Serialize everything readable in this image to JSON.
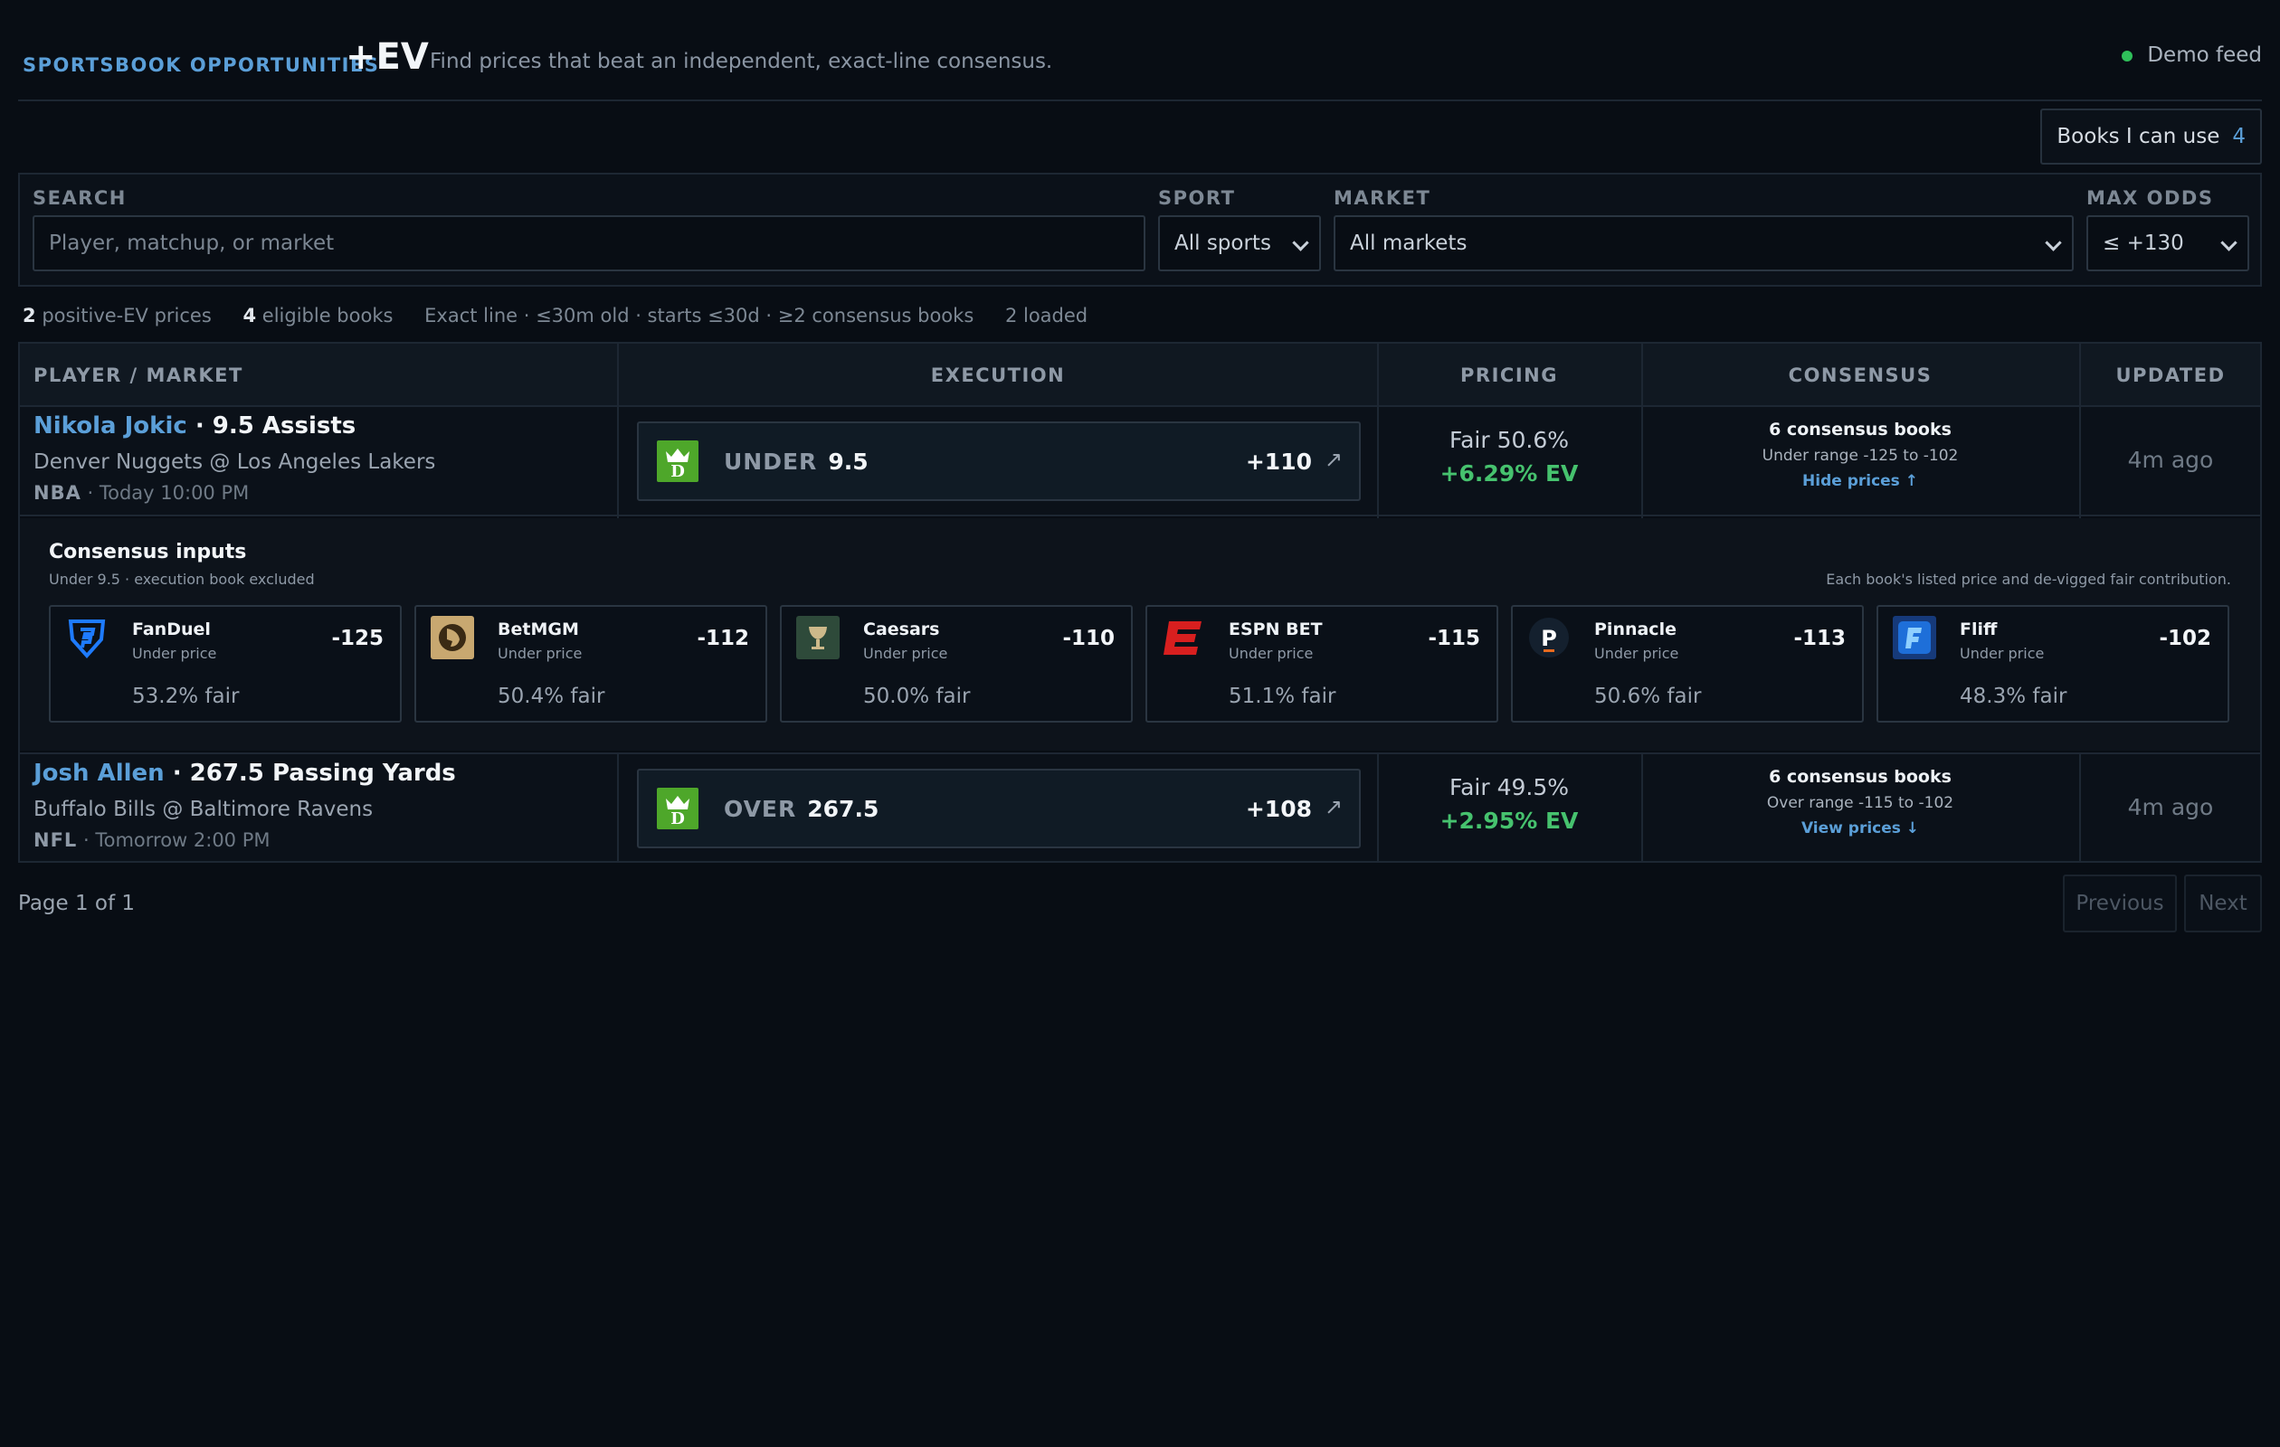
{
  "header": {
    "brand": "SPORTSBOOK OPPORTUNITIES",
    "ev_label": "+EV",
    "tagline": "Find prices that beat an independent, exact-line consensus.",
    "status": "Demo feed",
    "status_color": "#2fbf5a"
  },
  "books_button": {
    "label": "Books I can use",
    "count": "4"
  },
  "filters": {
    "search": {
      "label": "SEARCH",
      "placeholder": "Player, matchup, or market"
    },
    "sport": {
      "label": "SPORT",
      "value": "All sports"
    },
    "market": {
      "label": "MARKET",
      "value": "All markets"
    },
    "max_odds": {
      "label": "MAX ODDS",
      "value": "≤ +130"
    }
  },
  "stats": {
    "positive_count": "2",
    "positive_label": "positive-EV prices",
    "eligible_count": "4",
    "eligible_label": "eligible books",
    "rules": "Exact line · ≤30m old · starts ≤30d · ≥2 consensus books",
    "loaded": "2 loaded"
  },
  "table": {
    "columns": [
      "PLAYER / MARKET",
      "EXECUTION",
      "PRICING",
      "CONSENSUS",
      "UPDATED"
    ],
    "rows": [
      {
        "player": "Nikola Jokic",
        "market": " · 9.5 Assists",
        "matchup": "Denver Nuggets @ Los Angeles Lakers",
        "league": "NBA",
        "time": " · Today 10:00 PM",
        "side": "UNDER",
        "line": "9.5",
        "odds": "+110",
        "fair": "Fair 50.6%",
        "ev": "+6.29% EV",
        "consensus_books": "6 consensus books",
        "consensus_range": "Under range -125 to -102",
        "consensus_toggle": "Hide prices ↑",
        "updated": "4m ago"
      },
      {
        "player": "Josh Allen",
        "market": " · 267.5 Passing Yards",
        "matchup": "Buffalo Bills @ Baltimore Ravens",
        "league": "NFL",
        "time": " · Tomorrow 2:00 PM",
        "side": "OVER",
        "line": "267.5",
        "odds": "+108",
        "fair": "Fair 49.5%",
        "ev": "+2.95% EV",
        "consensus_books": "6 consensus books",
        "consensus_range": "Over range -115 to -102",
        "consensus_toggle": "View prices ↓",
        "updated": "4m ago"
      }
    ]
  },
  "consensus_panel": {
    "title": "Consensus inputs",
    "subtitle": "Under 9.5 · execution book excluded",
    "note": "Each book's listed price and de-vigged fair contribution.",
    "books": [
      {
        "name": "FanDuel",
        "sub": "Under price",
        "price": "-125",
        "fair": "53.2% fair",
        "icon": "fanduel-icon",
        "color": "#1e7bff"
      },
      {
        "name": "BetMGM",
        "sub": "Under price",
        "price": "-112",
        "fair": "50.4% fair",
        "icon": "betmgm-icon",
        "color": "#c8a870"
      },
      {
        "name": "Caesars",
        "sub": "Under price",
        "price": "-110",
        "fair": "50.0% fair",
        "icon": "caesars-icon",
        "color": "#2e4a3a"
      },
      {
        "name": "ESPN BET",
        "sub": "Under price",
        "price": "-115",
        "fair": "51.1% fair",
        "icon": "espnbet-icon",
        "color": "#d81f1f"
      },
      {
        "name": "Pinnacle",
        "sub": "Under price",
        "price": "-113",
        "fair": "50.6% fair",
        "icon": "pinnacle-icon",
        "color": "#0f1a2a"
      },
      {
        "name": "Fliff",
        "sub": "Under price",
        "price": "-102",
        "fair": "48.3% fair",
        "icon": "fliff-icon",
        "color": "#1e6fd9"
      }
    ]
  },
  "pagination": {
    "info": "Page 1 of 1",
    "previous": "Previous",
    "next": "Next"
  },
  "colors": {
    "accent": "#5b9fd8",
    "positive": "#46c26e",
    "draftkings": "#4ea72a"
  }
}
